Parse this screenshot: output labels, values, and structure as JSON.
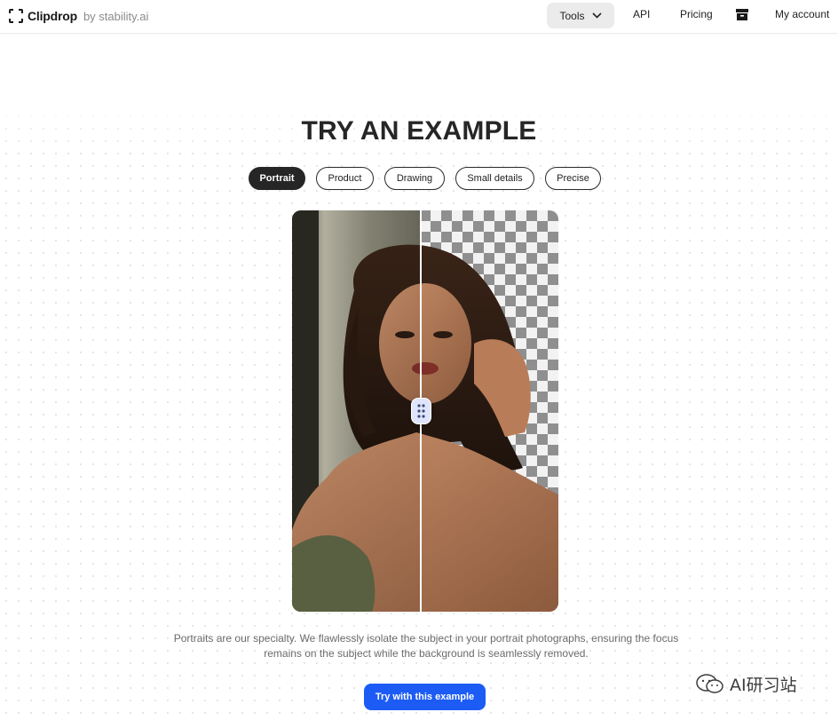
{
  "header": {
    "logo_name": "Clipdrop",
    "logo_suffix": "by stability.ai",
    "nav": {
      "tools_label": "Tools",
      "api_label": "API",
      "pricing_label": "Pricing",
      "account_label": "My account"
    },
    "icons": [
      "clipdrop-logo-icon",
      "chevron-down-icon",
      "archive-icon"
    ]
  },
  "main": {
    "heading": "TRY AN EXAMPLE",
    "tabs": [
      {
        "label": "Portrait",
        "active": true
      },
      {
        "label": "Product",
        "active": false
      },
      {
        "label": "Drawing",
        "active": false
      },
      {
        "label": "Small details",
        "active": false
      },
      {
        "label": "Precise",
        "active": false
      }
    ],
    "description": "Portraits are our specialty. We flawlessly isolate the subject in your portrait photographs, ensuring the focus remains on the subject while the background is seamlessly removed.",
    "cta_label": "Try with this example"
  },
  "watermark": {
    "text": "AI研习站"
  },
  "colors": {
    "accent": "#1c5cf5",
    "active_tab": "#262626",
    "handle": "#dfe6fb"
  }
}
